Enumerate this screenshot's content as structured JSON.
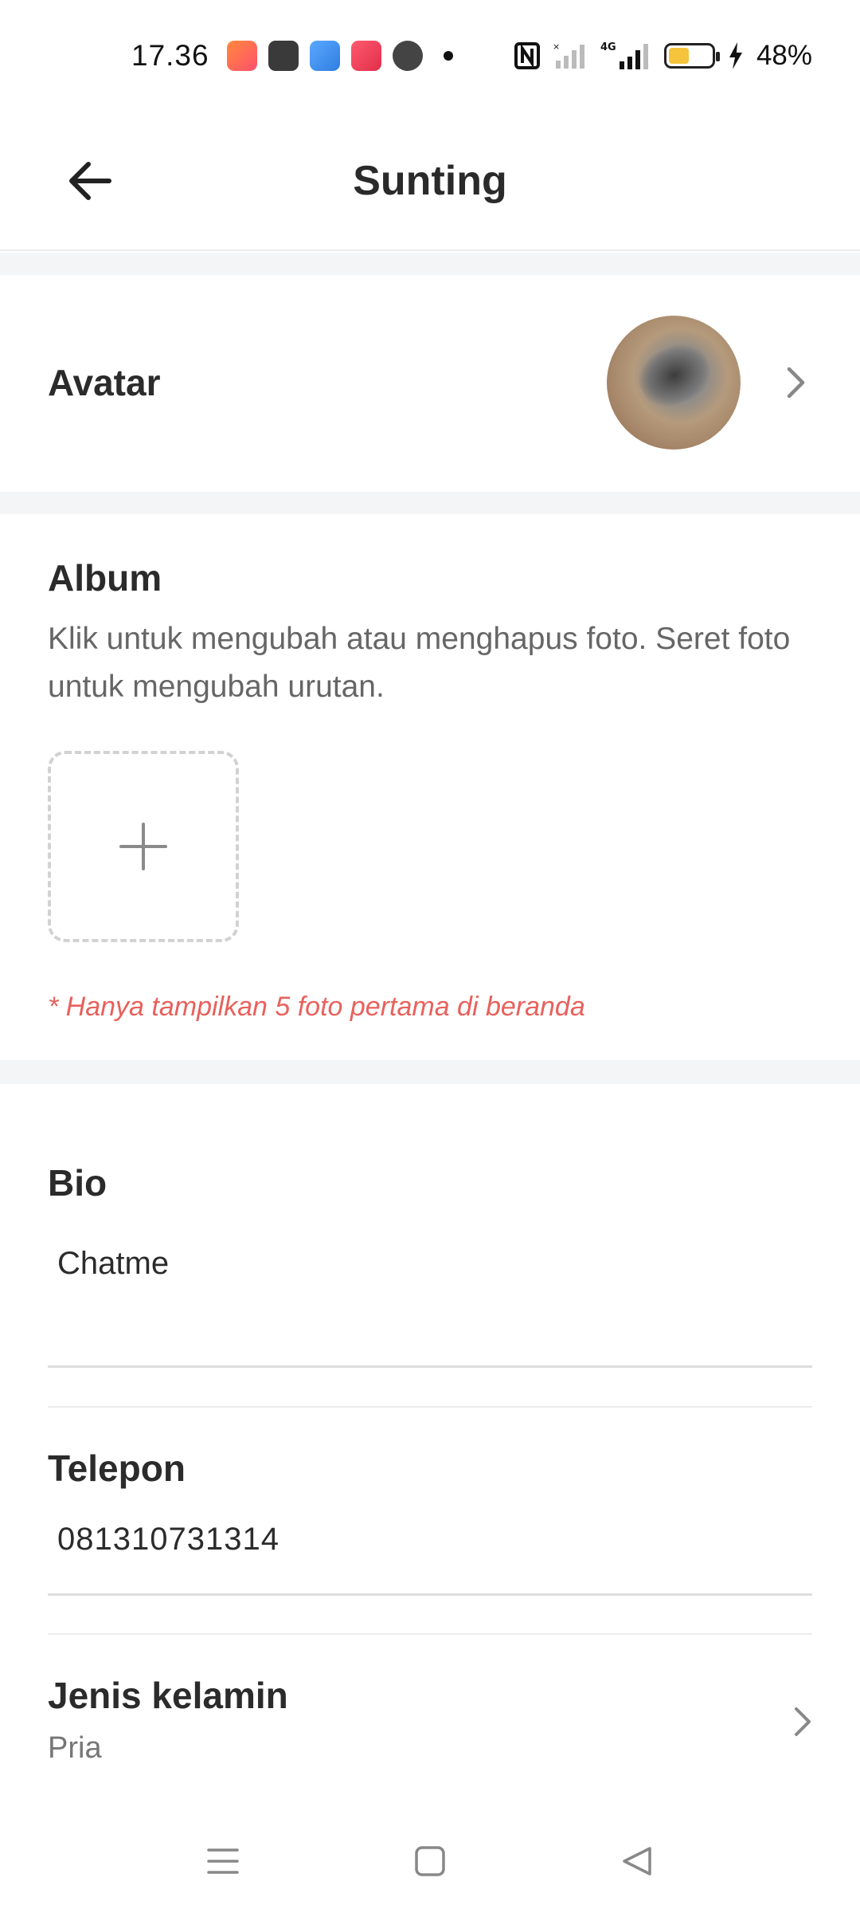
{
  "status_bar": {
    "time": "17.36",
    "battery": "48%",
    "battery_level": 0.48,
    "network": "4G",
    "notification_icons": [
      "game-icon",
      "cinema-icon",
      "weather-icon",
      "app-icon",
      "chat-icon"
    ]
  },
  "header": {
    "title": "Sunting",
    "back_icon": "arrow-left-icon"
  },
  "avatar_section": {
    "label": "Avatar"
  },
  "album": {
    "title": "Album",
    "description": "Klik untuk mengubah atau menghapus foto. Seret foto untuk mengubah urutan.",
    "note": "* Hanya tampilkan 5 foto pertama di beranda"
  },
  "bio": {
    "label": "Bio",
    "value": "Chatme"
  },
  "phone": {
    "label": "Telepon",
    "value": "081310731314"
  },
  "gender": {
    "label": "Jenis kelamin",
    "value": "Pria"
  },
  "colors": {
    "accent_note": "#e8615c",
    "section_gap": "#f4f5f7"
  }
}
